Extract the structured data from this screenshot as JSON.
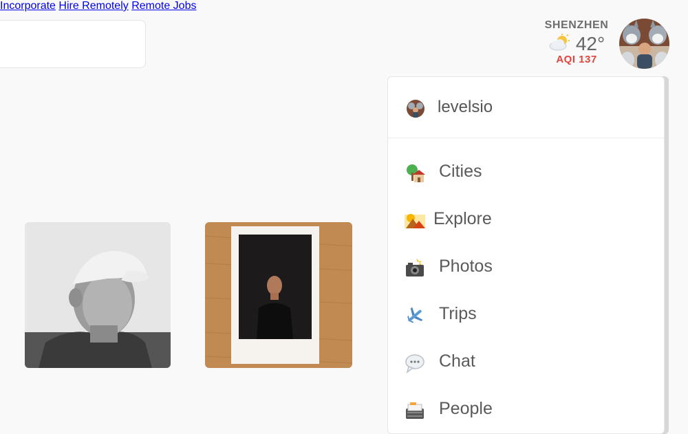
{
  "header": {
    "search": {
      "value": "",
      "placeholder": ""
    },
    "nav": [
      {
        "label": "Incorporate"
      },
      {
        "label": "Hire Remotely"
      },
      {
        "label": "Remote Jobs"
      }
    ],
    "weather": {
      "city": "SHENZHEN",
      "temperature": "42°",
      "aqi_label": "AQI",
      "aqi_value": "137",
      "icon": "partly-cloudy-icon"
    },
    "avatar": "user-avatar"
  },
  "dropdown": {
    "username": "levelsio",
    "items": [
      {
        "label": "Cities",
        "icon": "house-tree-icon"
      },
      {
        "label": "Explore",
        "icon": "sunrise-mountains-icon"
      },
      {
        "label": "Photos",
        "icon": "camera-flash-icon"
      },
      {
        "label": "Trips",
        "icon": "airplane-icon"
      },
      {
        "label": "Chat",
        "icon": "speech-bubble-icon"
      },
      {
        "label": "People",
        "icon": "card-index-icon"
      }
    ]
  },
  "photos": [
    {
      "name": "portrait-cap-photo"
    },
    {
      "name": "instant-photo"
    }
  ],
  "colors": {
    "background": "#f9f9f9",
    "aqi": "#e0443c",
    "text": "#666666"
  }
}
